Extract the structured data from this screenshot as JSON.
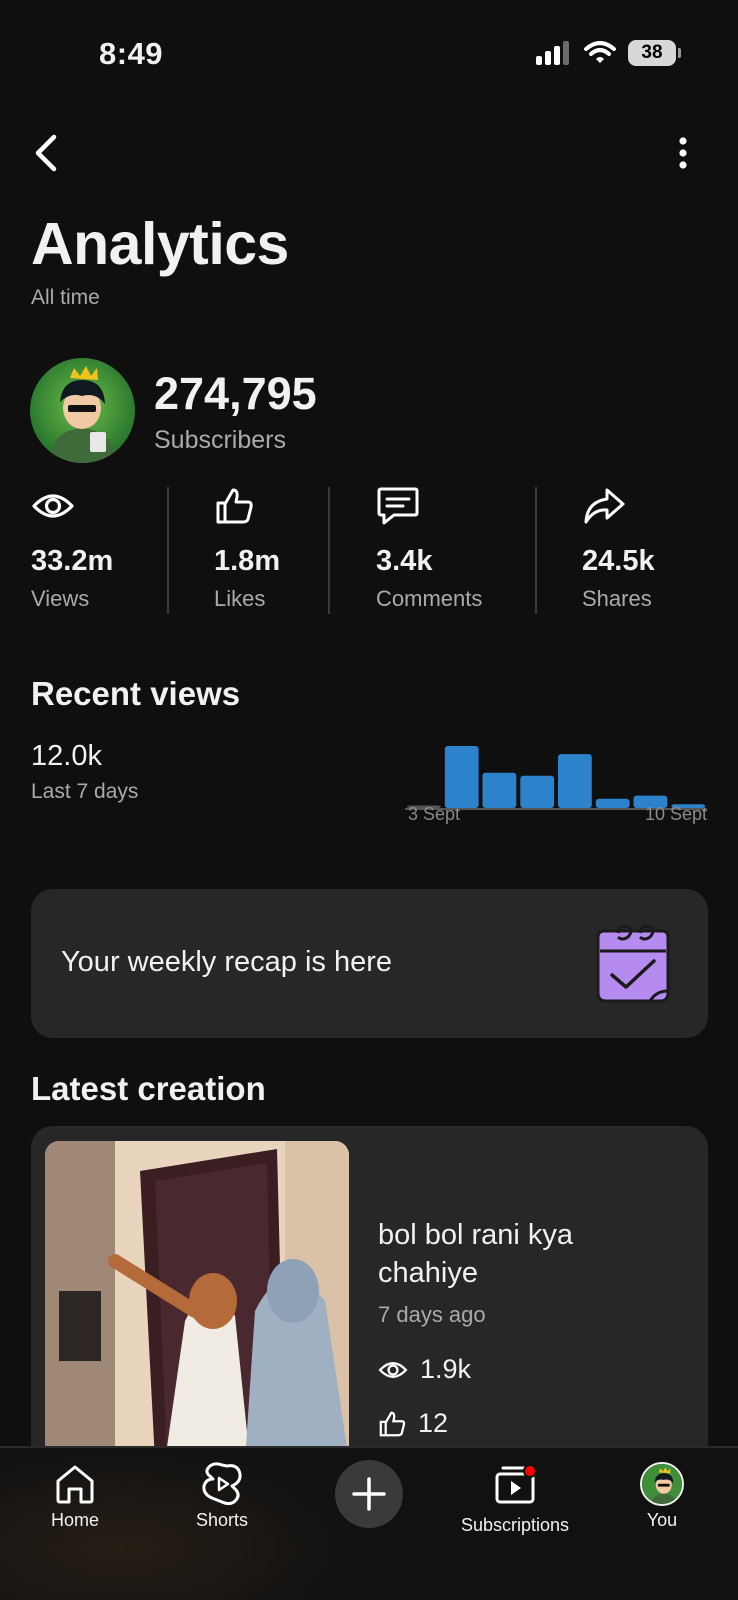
{
  "status_bar": {
    "time": "8:49",
    "battery": "38"
  },
  "header": {
    "title": "Analytics",
    "subtitle": "All time"
  },
  "channel": {
    "subscriber_count": "274,795",
    "subscriber_label": "Subscribers"
  },
  "stats": [
    {
      "icon": "eye-icon",
      "value": "33.2m",
      "label": "Views"
    },
    {
      "icon": "thumbs-up-icon",
      "value": "1.8m",
      "label": "Likes"
    },
    {
      "icon": "comment-icon",
      "value": "3.4k",
      "label": "Comments"
    },
    {
      "icon": "share-icon",
      "value": "24.5k",
      "label": "Shares"
    }
  ],
  "recent_views": {
    "title": "Recent views",
    "value": "12.0k",
    "period": "Last 7 days",
    "start_label": "3 Sept",
    "end_label": "10 Sept"
  },
  "chart_data": {
    "type": "bar",
    "values": [
      0.04,
      1.0,
      0.57,
      0.52,
      0.87,
      0.15,
      0.2,
      0.06
    ],
    "colors": {
      "bar": "#2d82cc",
      "baseline": "#555555"
    },
    "x_tick_labels": [
      "3 Sept",
      "10 Sept"
    ]
  },
  "recap": {
    "text": "Your weekly recap is here",
    "icon": "calendar-check-icon"
  },
  "latest": {
    "title": "Latest creation",
    "video_title": "bol bol rani kya chahiye",
    "age": "7 days ago",
    "views": "1.9k",
    "likes": "12"
  },
  "nav": {
    "home": "Home",
    "shorts": "Shorts",
    "subscriptions": "Subscriptions",
    "you": "You"
  },
  "colors": {
    "background": "#0f0f0f",
    "card": "#272727",
    "accent_blue": "#2d82cc",
    "recap_purple": "#b58bf0",
    "notification": "#ff0000"
  }
}
